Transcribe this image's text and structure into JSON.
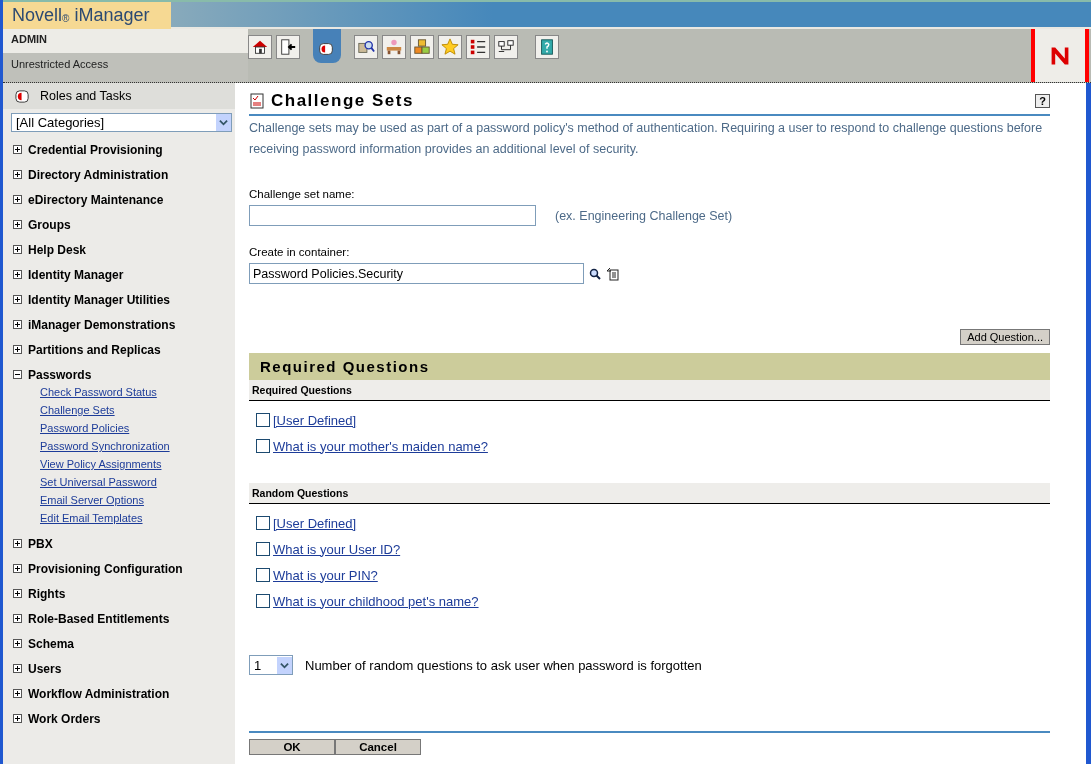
{
  "header": {
    "product": "Novell$_{®}$ iManager",
    "user": "ADMIN",
    "access": "Unrestricted Access"
  },
  "toolbar": [
    {
      "kind": "home",
      "selected": false
    },
    {
      "kind": "exit",
      "selected": false
    },
    {
      "kind": "roles",
      "selected": true
    },
    {
      "kind": "search",
      "selected": false
    },
    {
      "kind": "desk",
      "selected": false
    },
    {
      "kind": "cubes",
      "selected": false
    },
    {
      "kind": "star",
      "selected": false
    },
    {
      "kind": "checklist",
      "selected": false
    },
    {
      "kind": "network",
      "selected": false
    },
    {
      "kind": "help",
      "selected": false
    }
  ],
  "sidebar": {
    "title": "Roles and Tasks",
    "category": "[All Categories]",
    "items": [
      {
        "label": "Credential Provisioning",
        "expanded": false
      },
      {
        "label": "Directory Administration",
        "expanded": false
      },
      {
        "label": "eDirectory Maintenance",
        "expanded": false
      },
      {
        "label": "Groups",
        "expanded": false
      },
      {
        "label": "Help Desk",
        "expanded": false
      },
      {
        "label": "Identity Manager",
        "expanded": false
      },
      {
        "label": "Identity Manager Utilities",
        "expanded": false
      },
      {
        "label": "iManager Demonstrations",
        "expanded": false
      },
      {
        "label": "Partitions and Replicas",
        "expanded": false
      },
      {
        "label": "Passwords",
        "expanded": true,
        "children": [
          "Check Password Status",
          "Challenge Sets",
          "Password Policies",
          "Password Synchronization",
          "View Policy Assignments",
          "Set Universal Password",
          "Email Server Options",
          "Edit Email Templates"
        ]
      },
      {
        "label": "PBX",
        "expanded": false
      },
      {
        "label": "Provisioning Configuration",
        "expanded": false
      },
      {
        "label": "Rights",
        "expanded": false
      },
      {
        "label": "Role-Based Entitlements",
        "expanded": false
      },
      {
        "label": "Schema",
        "expanded": false
      },
      {
        "label": "Users",
        "expanded": false
      },
      {
        "label": "Workflow Administration",
        "expanded": false
      },
      {
        "label": "Work Orders",
        "expanded": false
      }
    ]
  },
  "page": {
    "title": "Challenge Sets",
    "help": "?",
    "description": "Challenge sets may be used as part of a password policy's method of authentication. Requiring a user to respond to challenge questions before receiving password information provides an additional level of security.",
    "name_label": "Challenge set name:",
    "name_hint": "(ex. Engineering Challenge Set)",
    "container_label": "Create in container:",
    "container_value": "Password Policies.Security",
    "add_button": "Add Question...",
    "section_title": "Required Questions",
    "groups": [
      {
        "title": "Required Questions",
        "questions": [
          {
            "text": "[User Defined]",
            "checked": false
          },
          {
            "text": "What is your mother's maiden name?",
            "checked": false
          }
        ]
      },
      {
        "title": "Random Questions",
        "questions": [
          {
            "text": "[User Defined]",
            "checked": false
          },
          {
            "text": "What is your User ID?",
            "checked": false
          },
          {
            "text": "What is your PIN?",
            "checked": false
          },
          {
            "text": "What is your childhood pet's name?",
            "checked": false
          }
        ]
      }
    ],
    "count_value": "1",
    "count_label": "Number of random questions to ask user when password is forgotten",
    "buttons": [
      "OK",
      "Cancel"
    ]
  }
}
